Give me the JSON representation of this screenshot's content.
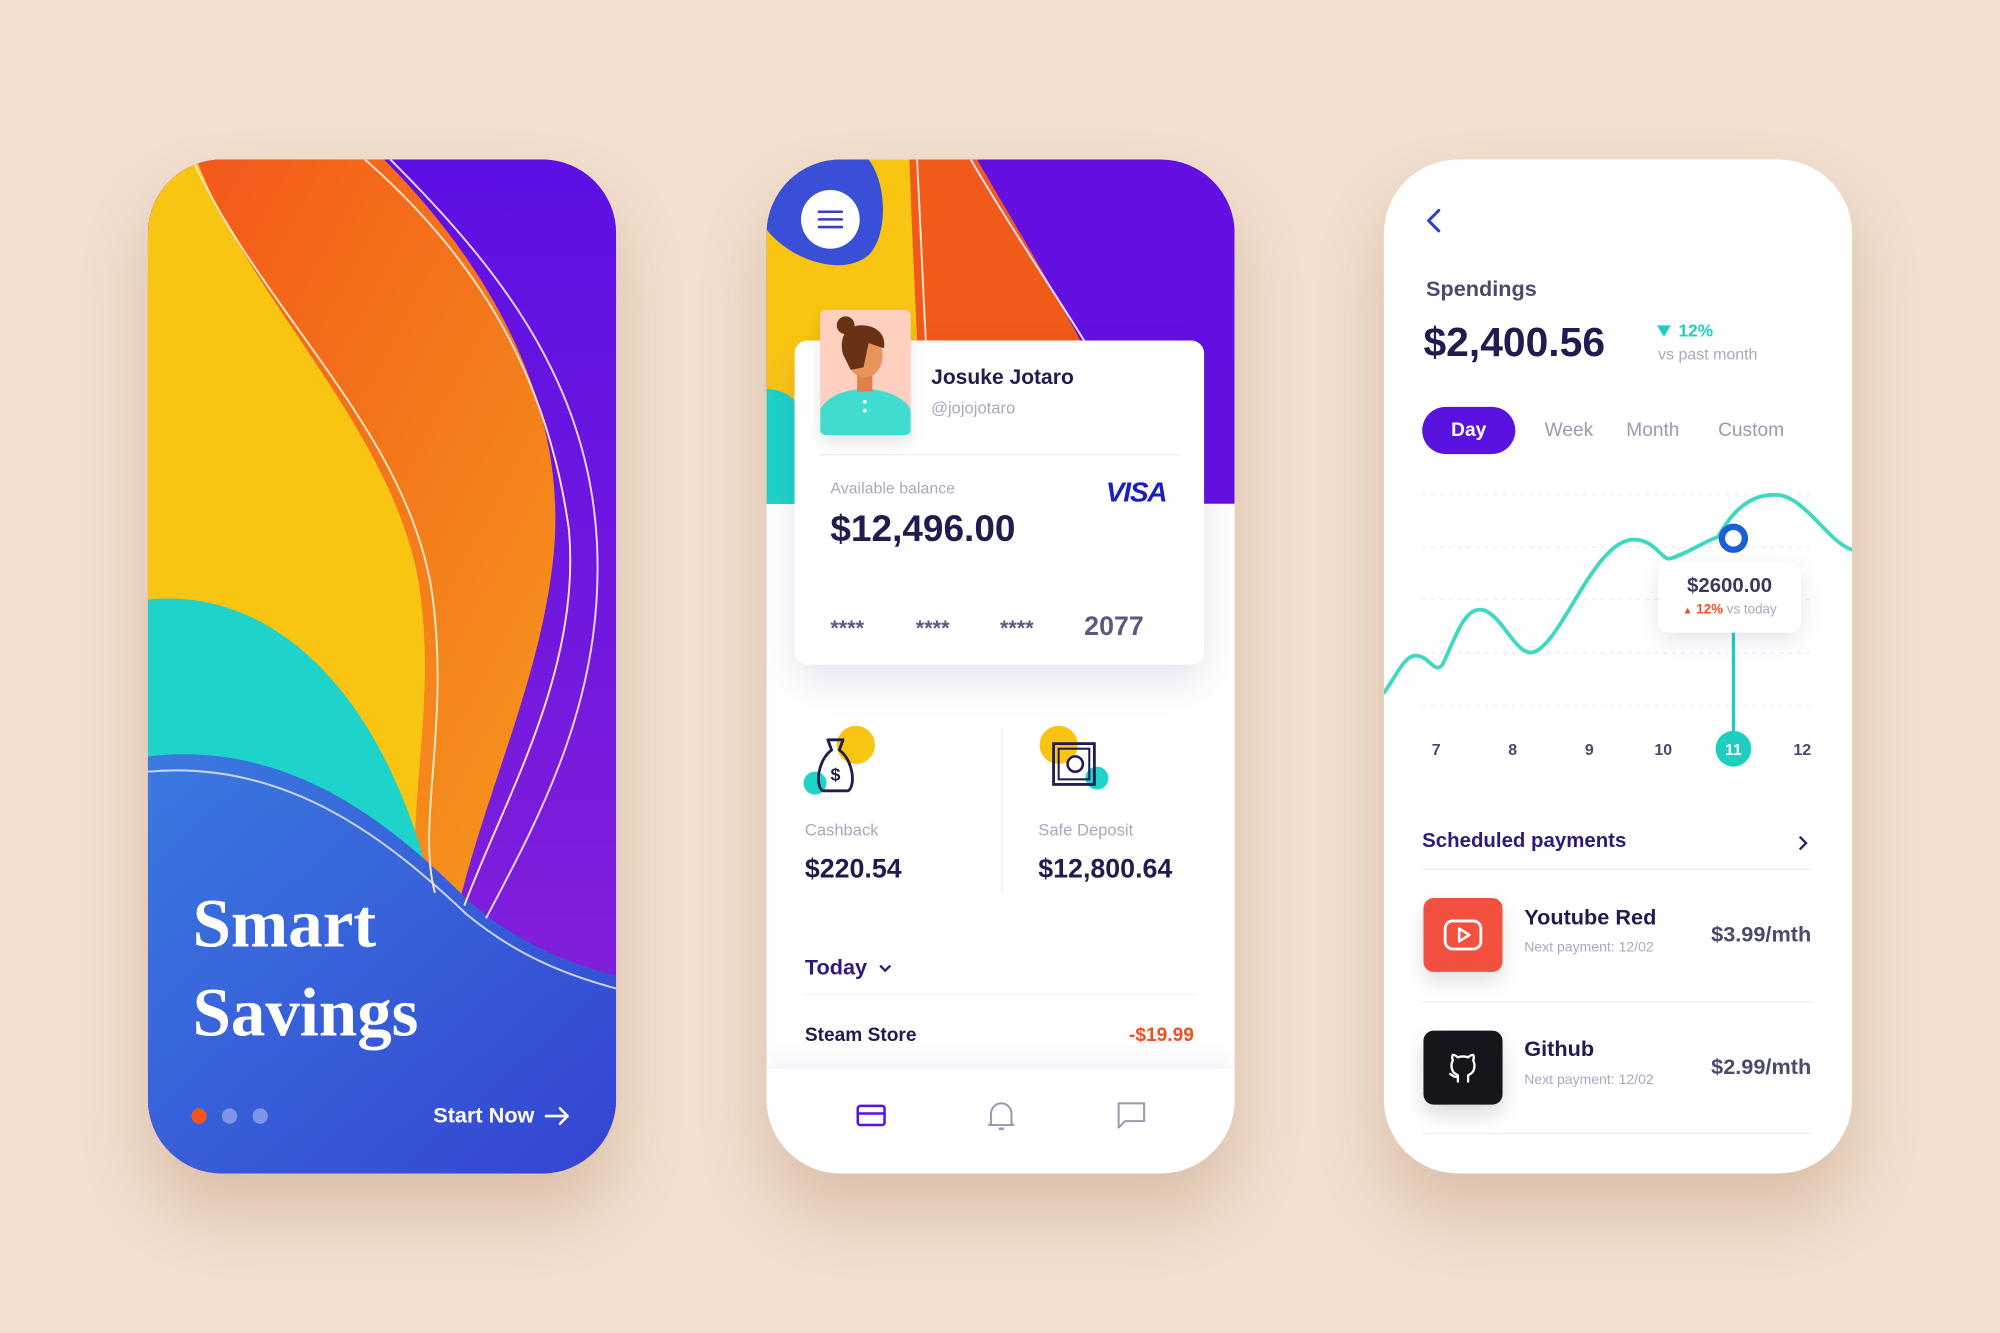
{
  "onboarding": {
    "title_line1": "Smart",
    "title_line2": "Savings",
    "cta": "Start Now",
    "cta_icon": "arrow-right-icon",
    "pager": {
      "count": 3,
      "active": 1
    }
  },
  "wallet": {
    "menu_icon": "hamburger-menu-icon",
    "user": {
      "name": "Josuke Jotaro",
      "handle": "@jojojotaro"
    },
    "card": {
      "balance_label": "Available balance",
      "balance": "$12,496.00",
      "brand": "VISA",
      "number_groups": [
        "****",
        "****",
        "****",
        "2077"
      ]
    },
    "stats": [
      {
        "label": "Cashback",
        "value": "$220.54",
        "icon": "money-bag-icon"
      },
      {
        "label": "Safe Deposit",
        "value": "$12,800.64",
        "icon": "safe-icon"
      }
    ],
    "filter": "Today",
    "transactions": [
      {
        "name": "Steam Store",
        "amount": "-$19.99"
      }
    ],
    "nav": [
      {
        "icon": "card-icon",
        "active": true
      },
      {
        "icon": "bell-icon",
        "active": false
      },
      {
        "icon": "chat-icon",
        "active": false
      }
    ]
  },
  "spendings": {
    "title": "Spendings",
    "amount": "$2,400.56",
    "change": "12%",
    "change_direction": "down",
    "change_caption": "vs past month",
    "tabs": [
      "Day",
      "Week",
      "Month",
      "Custom"
    ],
    "active_tab": "Day",
    "scheduled_title": "Scheduled payments",
    "payments": [
      {
        "name": "Youtube Red",
        "next": "Next payment: 12/02",
        "price": "$3.99/mth",
        "icon": "youtube-play-icon",
        "color": "#f4503f"
      },
      {
        "name": "Github",
        "next": "Next payment: 12/02",
        "price": "$2.99/mth",
        "icon": "github-icon",
        "color": "#15161c"
      }
    ]
  },
  "chart_data": {
    "type": "line",
    "categories": [
      "7",
      "8",
      "9",
      "10",
      "11",
      "12"
    ],
    "selected": "11",
    "tooltip": {
      "value": "$2600.00",
      "change": "12%",
      "change_direction": "up",
      "caption": "vs today"
    },
    "grid": true,
    "line_color": "#3fd8c0"
  },
  "colors": {
    "background": "#f1dfcf",
    "primary_purple": "#5a12e0",
    "teal": "#1ecfc0",
    "orange": "#f26a1b",
    "yellow": "#f9c513",
    "navy_text": "#1f1c4f",
    "negative": "#f0501e"
  }
}
